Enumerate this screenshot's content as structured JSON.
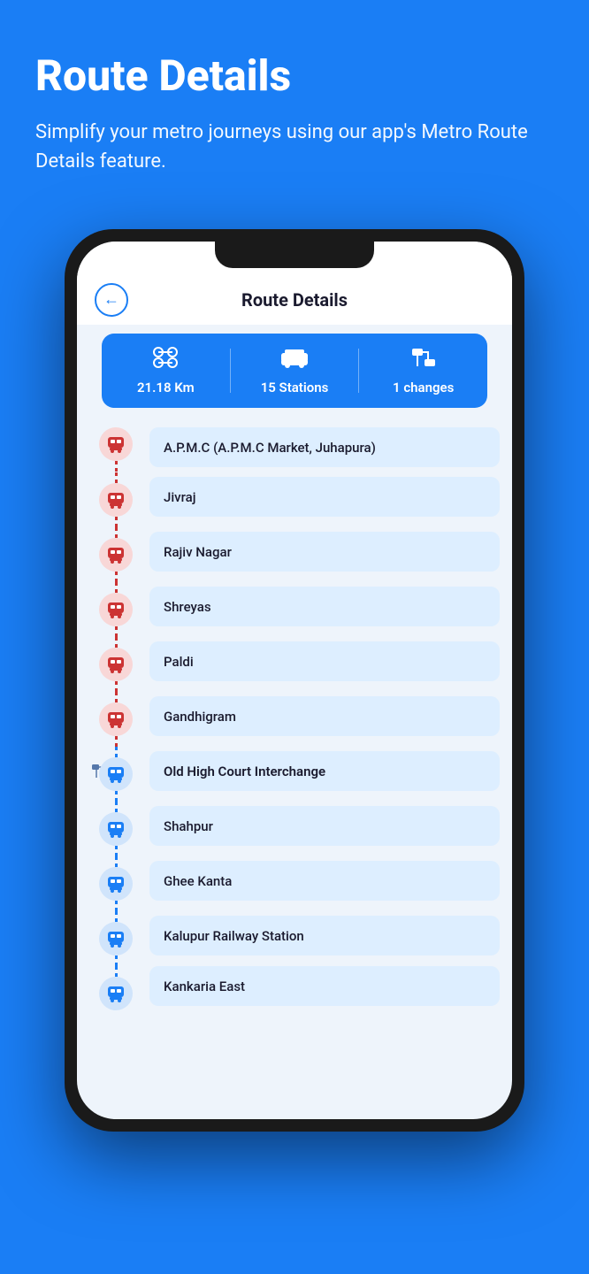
{
  "hero": {
    "title": "Route Details",
    "subtitle": "Simplify your metro journeys using our app's Metro Route Details feature."
  },
  "app": {
    "header_title": "Route Details",
    "back_label": "←"
  },
  "stats": {
    "distance": {
      "icon": "🔀",
      "value": "21.18 Km"
    },
    "stations": {
      "icon": "🚇",
      "value": "15 Stations"
    },
    "changes": {
      "icon": "🔁",
      "value": "1 changes"
    }
  },
  "stations": [
    {
      "name": "A.P.M.C (A.P.M.C Market, Juhapura)",
      "type": "red",
      "interchange": false
    },
    {
      "name": "Jivraj",
      "type": "red",
      "interchange": false
    },
    {
      "name": "Rajiv Nagar",
      "type": "red",
      "interchange": false
    },
    {
      "name": "Shreyas",
      "type": "red",
      "interchange": false
    },
    {
      "name": "Paldi",
      "type": "red",
      "interchange": false
    },
    {
      "name": "Gandhigram",
      "type": "red",
      "interchange": false
    },
    {
      "name": "Old High Court Interchange",
      "type": "blue",
      "interchange": true
    },
    {
      "name": "Shahpur",
      "type": "blue",
      "interchange": false
    },
    {
      "name": "Ghee Kanta",
      "type": "blue",
      "interchange": false
    },
    {
      "name": "Kalupur Railway Station",
      "type": "blue",
      "interchange": false
    },
    {
      "name": "Kankaria East",
      "type": "blue",
      "interchange": false
    }
  ]
}
